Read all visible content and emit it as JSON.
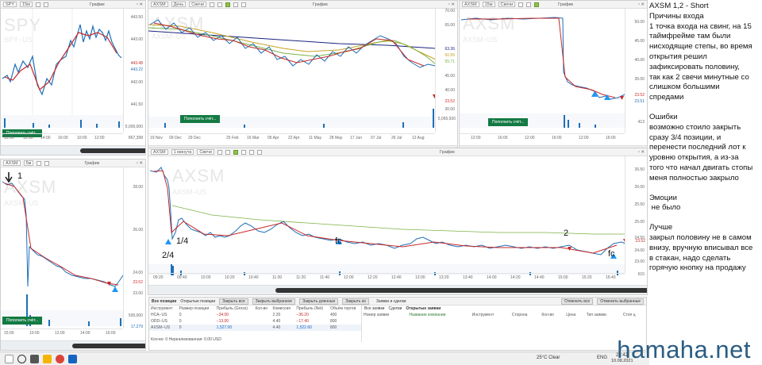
{
  "panes": {
    "spy": {
      "symbol": "SPY",
      "interval": "15м",
      "kind": "График",
      "watermark": "SPY",
      "watermark_sub": "SPY−US",
      "btn": "Пополнить счёт...",
      "prices": [
        "443.50",
        "443.00",
        "442.50",
        "442.00",
        "441.50"
      ],
      "last": "443.48",
      "last2": "443.22",
      "vol": [
        "5,000,000",
        "867,398"
      ],
      "times": [
        "10:00",
        "12:00",
        "14:00",
        "16:00",
        "10:00",
        "12:00",
        "14:00",
        "16:00"
      ]
    },
    "axsm_day": {
      "symbol": "AXSM",
      "interval": "День",
      "style": "Свечи",
      "kind": "График",
      "watermark": "AXSM",
      "watermark_sub": "AXSM−US",
      "btn": "Пополнить счёт...",
      "prices": [
        "70.00",
        "65.00",
        "60.00",
        "55.00",
        "50.00",
        "45.00",
        "40.00",
        "35.00",
        "30.00",
        "25.00"
      ],
      "ma": [
        "63.36",
        "60.89",
        "55.71"
      ],
      "last": "23.52",
      "vol": "5,065,930",
      "dates": [
        "19 Nov",
        "09 Dec",
        "29 Dec",
        "25 Feb",
        "16 Mar",
        "05 Apr",
        "22 Apr",
        "11 May",
        "28 May",
        "17 Jun",
        "07 Jul",
        "26 Jul",
        "12 Aug"
      ]
    },
    "axsm_15": {
      "symbol": "AXSM",
      "interval": "15м",
      "style": "Свечи",
      "kind": "График",
      "watermark": "AXSM",
      "watermark_sub": "AXSM−US",
      "btn": "Пополнить счёт...",
      "prices": [
        "50.00",
        "45.00",
        "40.00",
        "35.00",
        "30.00",
        "25.00"
      ],
      "last": "23.52",
      "last2": "23.51",
      "vol": "413",
      "times": [
        "12:00",
        "16:00",
        "12:00",
        "16:00",
        "12:00",
        "16:00"
      ]
    },
    "axsm_5": {
      "symbol": "AXSM",
      "interval": "5м",
      "kind": "График",
      "watermark": "AXSM",
      "watermark_sub": "AXSM−US",
      "btn": "Пополнить счёт...",
      "prices": [
        "28.00",
        "26.00",
        "24.00",
        "23.52",
        "23.00"
      ],
      "vol": [
        "500,000",
        "17,279"
      ],
      "times": [
        "15:00",
        "10:00",
        "12:00",
        "14:00",
        "16:00"
      ]
    },
    "axsm_1": {
      "symbol": "AXSM",
      "interval": "1 минута",
      "style": "Свечи",
      "kind": "График",
      "watermark": "AXSM",
      "watermark_sub": "AXSM−US",
      "prices": [
        "26.50",
        "26.00",
        "25.50",
        "25.00",
        "24.50",
        "24.00",
        "23.52",
        "23.00"
      ],
      "vol": "615",
      "times": [
        "09:20",
        "09:40",
        "10:00",
        "10:20",
        "10:40",
        "11:00",
        "11:20",
        "11:40",
        "12:00",
        "12:20",
        "12:40",
        "13:00",
        "13:20",
        "13:40",
        "14:00",
        "14:20",
        "14:40",
        "15:00",
        "15:20",
        "15:40"
      ]
    }
  },
  "annotations": {
    "a1": "1",
    "a2": "1/4",
    "a3": "2/4",
    "a4": "fc",
    "a5": "2",
    "a6": "fc"
  },
  "notes": {
    "title": "AXSM 1,2 - Short",
    "entry_head": "Причины входа",
    "entry": [
      "1 точка входа на свинг, на 15",
      "таймфрейме там были",
      "нисходящие степы, во время",
      "открытия решил",
      "зафиксировать половину,",
      "так как 2 свечи минутные со",
      "слишком большими",
      "спредами"
    ],
    "err_head": "Ошибки",
    "err": [
      "возможно стоило закрыть",
      "сразу 3/4 позиции, и",
      "перенести последний лот к",
      "уровню открытия, а из-за",
      "того что начал двигать стопы",
      "меня полностью закрыло"
    ],
    "emo_head": "Эмоции",
    "emo": [
      " не было"
    ],
    "better_head": "Лучше",
    "better": [
      "закрыл половину не в самом",
      "внизу, вручную вписывал все",
      "в стакан, надо сделать",
      "горячую кнопку на продажу"
    ]
  },
  "brand": "hamaha.net",
  "positions": {
    "tabs": [
      "Все позиции",
      "Открытые позиции"
    ],
    "buttons": [
      "Закрыть все",
      "Закрыть выбранное",
      "Закрыть длинные",
      "Закрыть ко"
    ],
    "headers": [
      "Инструмент",
      "Размер позиции",
      "Прибыль (Gross)",
      "Кол-во",
      "Комиссия",
      "Прибыль (Net)",
      "Объём торгов"
    ],
    "rows": [
      [
        "HCA−US",
        "0",
        "−34.00",
        "2.20",
        "−36.20",
        "400"
      ],
      [
        "ODD−US",
        "0",
        "−13.00",
        "4.40",
        "−17.40",
        "800"
      ],
      [
        "AXSM−US",
        "0",
        "1,527.00",
        "4.40",
        "1,522.60",
        "800"
      ]
    ],
    "footer": "Кол-во: 0   Нереализованная: 0.00 USD"
  },
  "orders": {
    "title": "Заявки и сделки",
    "tabs": [
      "Все заявки",
      "Сделки",
      "Открытые заявки"
    ],
    "buttons": [
      "Отменить все",
      "Отменить выбранные"
    ],
    "headers": [
      "Номер заявки",
      "Название компании",
      "Инструмент",
      "Сторона",
      "Кол-во",
      "Цена",
      "Тип заявки",
      "Стоп ц"
    ]
  },
  "taskbar": {
    "weather": "25°C  Clear",
    "lang": "ENG",
    "time": "22:42",
    "date": "10.08.2021"
  }
}
